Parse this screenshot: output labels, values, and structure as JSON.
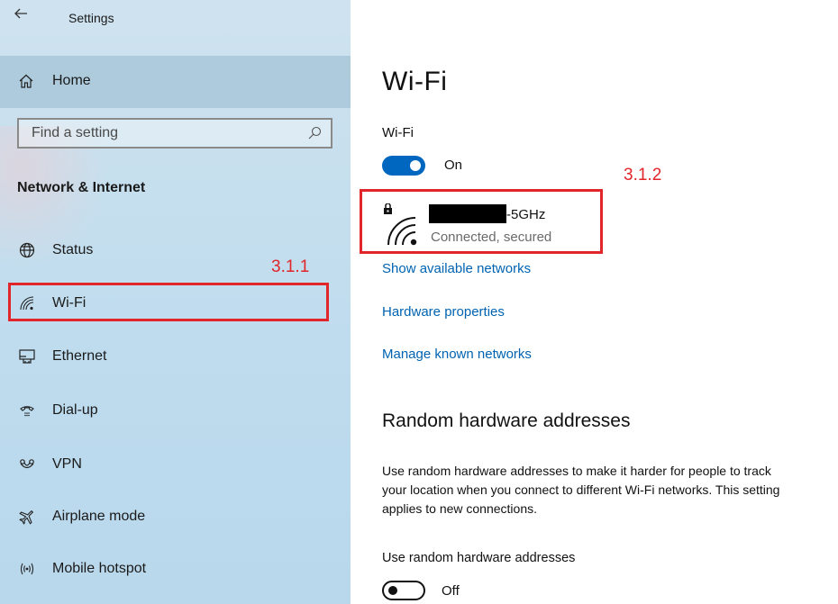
{
  "window": {
    "title": "Settings",
    "back_icon": "back-arrow-icon"
  },
  "sidebar": {
    "home_label": "Home",
    "search": {
      "placeholder": "Find a setting"
    },
    "section_title": "Network & Internet",
    "items": [
      {
        "label": "Status",
        "icon": "globe-icon"
      },
      {
        "label": "Wi-Fi",
        "icon": "wifi-icon"
      },
      {
        "label": "Ethernet",
        "icon": "ethernet-icon"
      },
      {
        "label": "Dial-up",
        "icon": "dialup-icon"
      },
      {
        "label": "VPN",
        "icon": "vpn-icon"
      },
      {
        "label": "Airplane mode",
        "icon": "airplane-icon"
      },
      {
        "label": "Mobile hotspot",
        "icon": "hotspot-icon"
      }
    ]
  },
  "annotations": {
    "sidebar_wifi": "3.1.1",
    "network": "3.1.2",
    "color": "#e0262b"
  },
  "main": {
    "title": "Wi-Fi",
    "wifi_toggle": {
      "label": "Wi-Fi",
      "state": "On",
      "color": "#0067c0"
    },
    "network": {
      "name_suffix": "-5GHz",
      "status": "Connected, secured"
    },
    "links": [
      "Show available networks",
      "Hardware properties",
      "Manage known networks"
    ],
    "random_section": {
      "title": "Random hardware addresses",
      "description_lines": [
        "Use random hardware addresses to make it harder for people to track",
        "your location when you connect to different Wi-Fi networks. This setting",
        "applies to new connections."
      ],
      "toggle_label": "Use random hardware addresses",
      "toggle_state": "Off"
    }
  }
}
